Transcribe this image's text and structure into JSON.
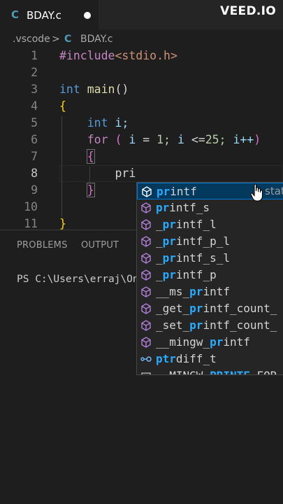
{
  "tab": {
    "icon": "C",
    "title": "BDAY.c",
    "dirty": true
  },
  "watermark": "VEED.IO",
  "breadcrumb": {
    "folder": ".vscode",
    "separator": ">",
    "icon": "C",
    "file": "BDAY.c"
  },
  "editor": {
    "line_numbers": [
      "1",
      "2",
      "3",
      "4",
      "5",
      "6",
      "7",
      "8",
      "9",
      "10",
      "11"
    ],
    "lines": {
      "l1_directive": "#include",
      "l1_header": "<stdio.h>",
      "l3_type": "int",
      "l3_name": "main",
      "l3_parens": "()",
      "l4_brace": "{",
      "l5_type": "int",
      "l5_var": "i;",
      "l6_for": "for",
      "l6_open": "(",
      "l6_i": "i",
      "l6_eq": "=",
      "l6_one": "1;",
      "l6_i2": "i",
      "l6_le": "<=",
      "l6_25": "25;",
      "l6_incr": "i++",
      "l6_close": ")",
      "l7_brace": "{",
      "l8_typed": "pri",
      "l9_brace": "}",
      "l11_brace": "}"
    }
  },
  "panel": {
    "tabs": [
      "PROBLEMS",
      "OUTPUT"
    ],
    "terminal_prompt": "PS C:\\Users\\erraj\\On"
  },
  "suggestions": [
    {
      "match": "pr",
      "rest": "intf",
      "icon": "cube-icon",
      "detail": "stati"
    },
    {
      "match": "pr",
      "rest": "intf_s",
      "prefix": "",
      "icon": "cube-icon"
    },
    {
      "prefix": "_",
      "match": "pr",
      "rest": "intf_l",
      "icon": "cube-icon"
    },
    {
      "prefix": "_",
      "match": "pr",
      "rest": "intf_p_l",
      "icon": "cube-icon"
    },
    {
      "prefix": "_",
      "match": "pr",
      "rest": "intf_s_l",
      "icon": "cube-icon"
    },
    {
      "prefix": "_",
      "match": "pr",
      "rest": "intf_p",
      "icon": "cube-icon"
    },
    {
      "prefix": "__ms_",
      "match": "pr",
      "rest": "intf",
      "icon": "cube-icon"
    },
    {
      "prefix": "_get_",
      "match": "pr",
      "rest": "intf_count_",
      "icon": "cube-icon"
    },
    {
      "prefix": "_set_",
      "match": "pr",
      "rest": "intf_count_",
      "icon": "cube-icon"
    },
    {
      "prefix": "__mingw_",
      "match": "pr",
      "rest": "intf",
      "icon": "cube-icon"
    },
    {
      "prefix": "",
      "match": "ptr",
      "rest": "diff_t",
      "icon": "typedef-icon"
    },
    {
      "prefix": "__MINGW_",
      "match": "PRINTF",
      "rest": "_FOR",
      "icon": "constant-icon"
    }
  ],
  "colors": {
    "accent": "#0078d4",
    "match_highlight": "#2aaaff",
    "selection_bg": "#04395e"
  }
}
